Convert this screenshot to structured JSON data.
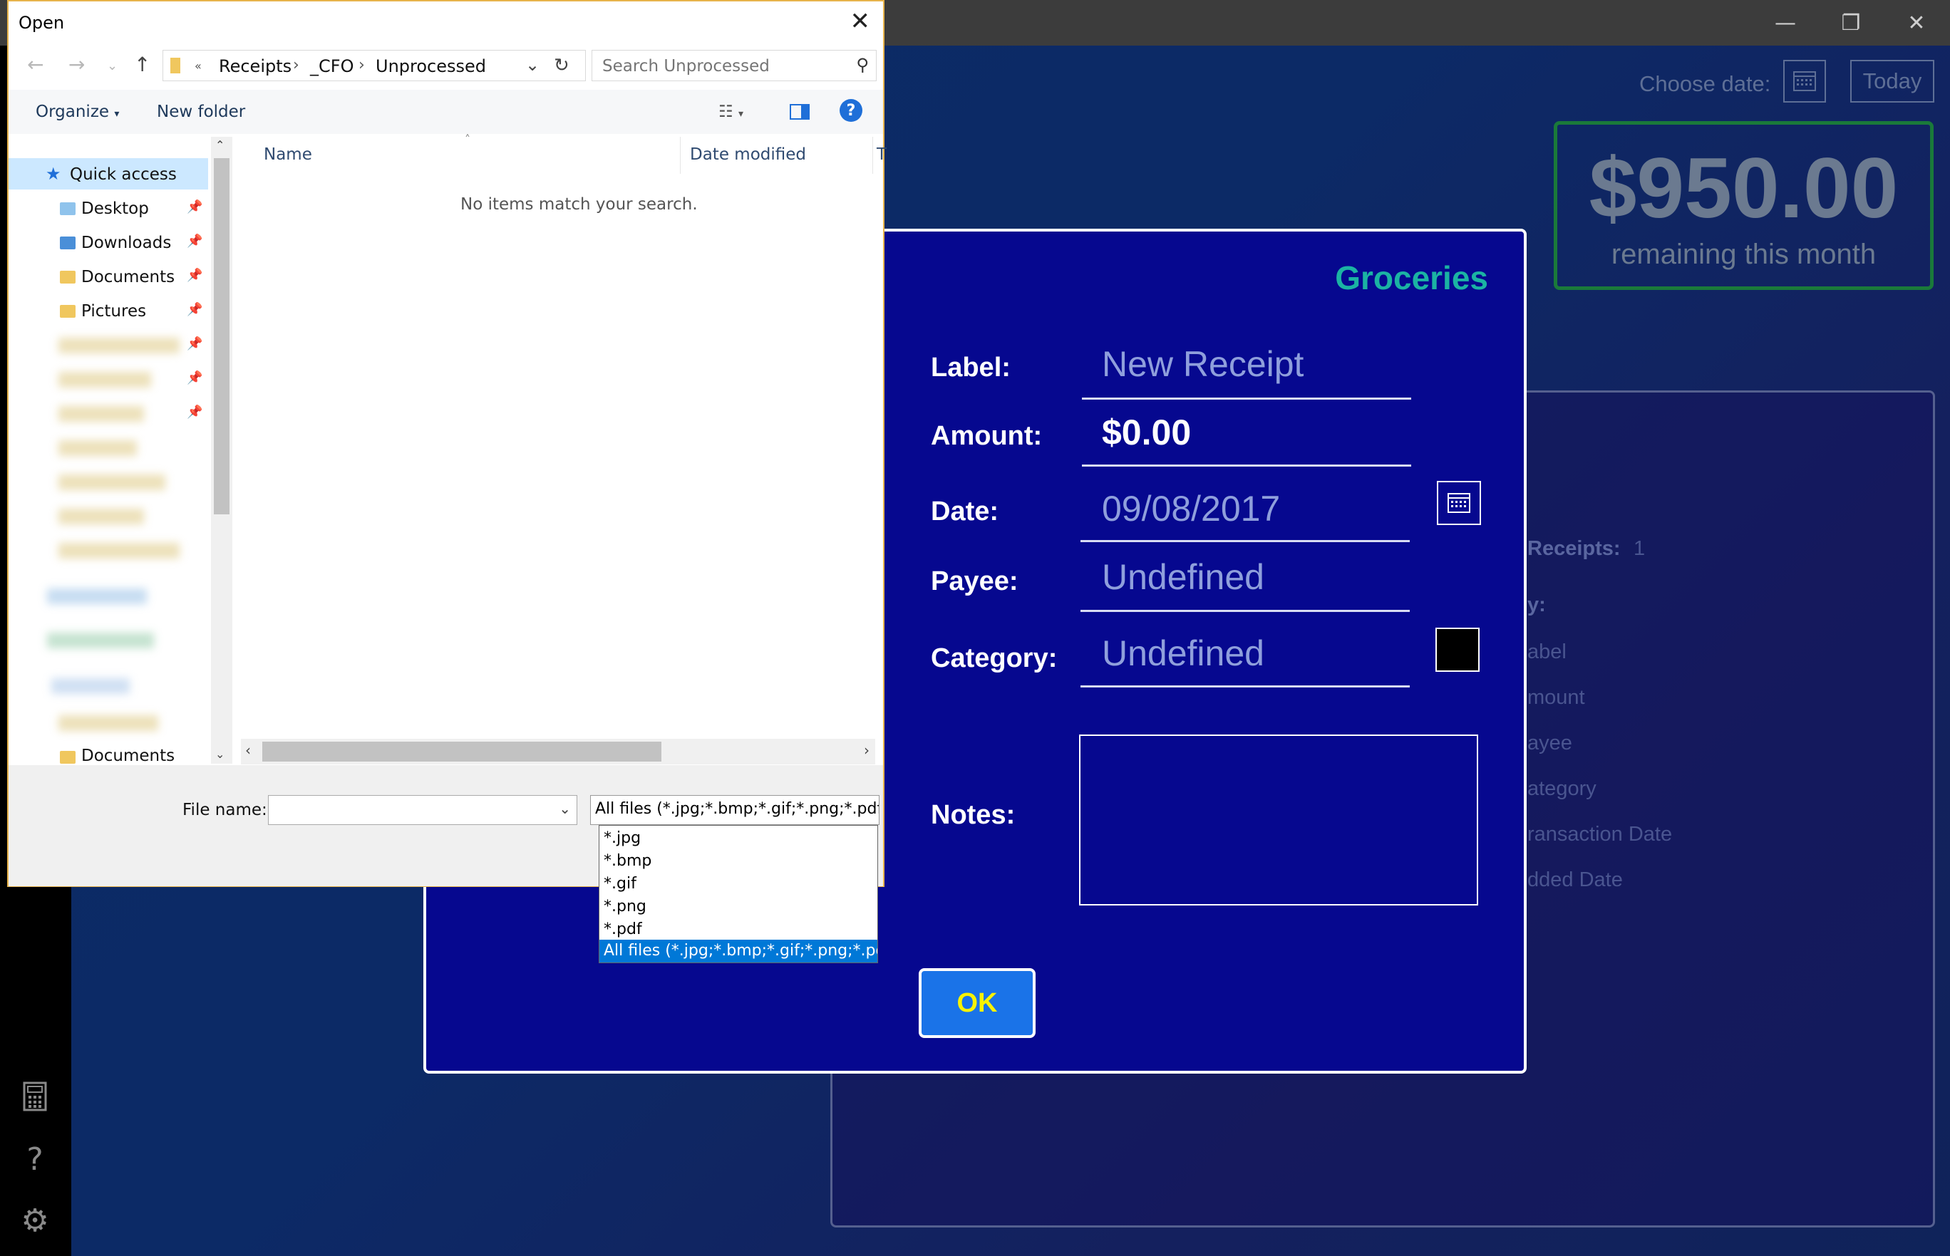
{
  "background_app": {
    "choose_date_label": "Choose date:",
    "today_label": "Today",
    "budget_amount": "$950.00",
    "budget_caption": "remaining this month",
    "receipts_label": "Receipts:",
    "receipts_count": "1",
    "sort_label": "y:",
    "sort_options": [
      "abel",
      "mount",
      "ayee",
      "ategory",
      "ransaction Date",
      "dded Date"
    ],
    "window_controls": {
      "minimize": "—",
      "restore": "❐",
      "close": "✕"
    }
  },
  "receipt_dialog": {
    "category_title": "Groceries",
    "fields": [
      {
        "label": "Label:",
        "value": "New Receipt"
      },
      {
        "label": "Amount:",
        "value": "$0.00"
      },
      {
        "label": "Date:",
        "value": "09/08/2017"
      },
      {
        "label": "Payee:",
        "value": "Undefined"
      },
      {
        "label": "Category:",
        "value": "Undefined"
      }
    ],
    "notes_label": "Notes:",
    "notes_value": "",
    "ok_label": "OK",
    "category_color": "#000000"
  },
  "open_dialog": {
    "title": "Open",
    "breadcrumb": [
      "Receipts",
      "_CFO",
      "Unprocessed"
    ],
    "search_placeholder": "Search Unprocessed",
    "toolbar": {
      "organize": "Organize",
      "new_folder": "New folder"
    },
    "nav": {
      "quick_access": "Quick access",
      "items": [
        "Desktop",
        "Downloads",
        "Documents",
        "Pictures"
      ],
      "bottom_item": "Documents"
    },
    "columns": {
      "name": "Name",
      "date_modified": "Date modified",
      "type": "T"
    },
    "empty_message": "No items match your search.",
    "file_name_label": "File name:",
    "file_name_value": "",
    "file_type_selected": "All files (*.jpg;*.bmp;*.gif;*.png;*.pdf)",
    "file_type_options": [
      "*.jpg",
      "*.bmp",
      "*.gif",
      "*.png",
      "*.pdf",
      "All files (*.jpg;*.bmp;*.gif;*.png;*.pdf)"
    ]
  }
}
